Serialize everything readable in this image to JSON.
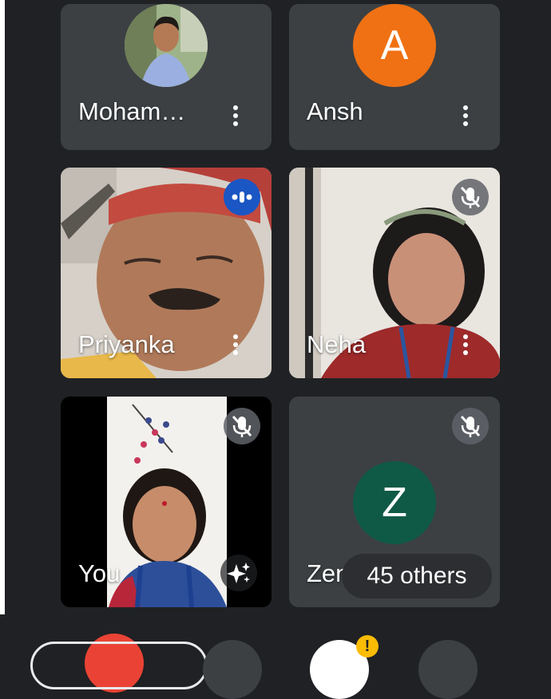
{
  "participants": {
    "p1": {
      "name": "Moham…"
    },
    "p2": {
      "name": "Ansh",
      "initial": "A",
      "color": "#f07113"
    },
    "p3": {
      "name": "Priyanka",
      "status": "speaking"
    },
    "p4": {
      "name": "Neha",
      "status": "muted"
    },
    "p5": {
      "name": "You",
      "status": "muted"
    },
    "p6": {
      "name": "Zenul",
      "initial": "Z",
      "color": "#0f5a46",
      "status": "muted"
    }
  },
  "overflow": {
    "label": "45 others"
  },
  "colors": {
    "background": "#202124",
    "tile": "#3c4043",
    "speaking": "#1a56c4",
    "end_call": "#ea4335",
    "alert": "#fbbc04"
  }
}
